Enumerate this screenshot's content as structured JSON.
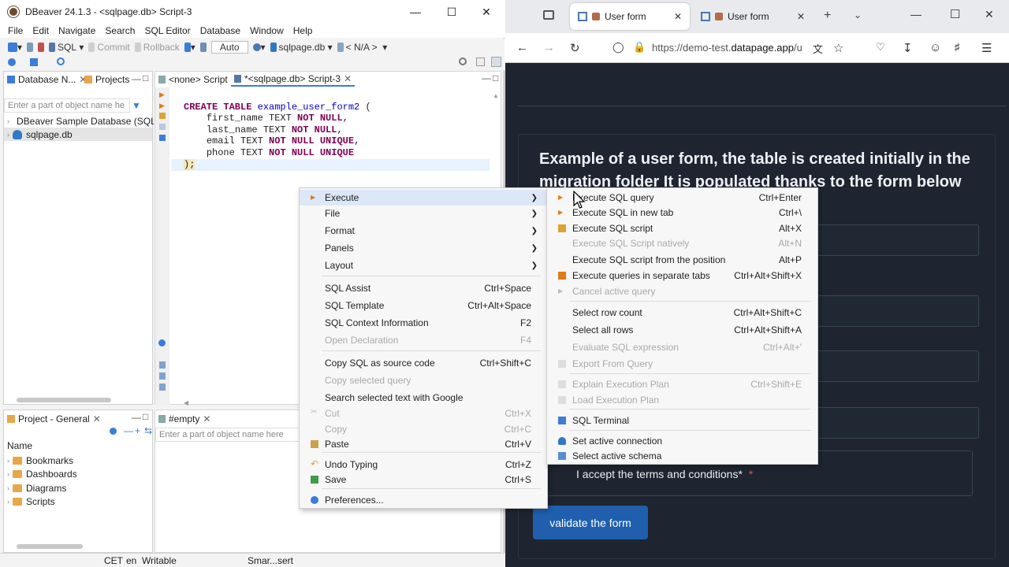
{
  "dbeaver": {
    "window_title": "DBeaver 24.1.3 - <sqlpage.db> Script-3",
    "menu": [
      "File",
      "Edit",
      "Navigate",
      "Search",
      "SQL Editor",
      "Database",
      "Window",
      "Help"
    ],
    "toolbar": {
      "sql_label": "SQL",
      "commit_label": "Commit",
      "rollback_label": "Rollback",
      "auto_label": "Auto",
      "connection_label": "sqlpage.db",
      "schema_label": "< N/A >"
    },
    "db_navigator": {
      "tab_label": "Database N...",
      "projects_tab": "Projects",
      "filter_placeholder": "Enter a part of object name he",
      "items": [
        {
          "label": "DBeaver Sample Database (SQLi"
        },
        {
          "label": "sqlpage.db"
        }
      ]
    },
    "editor": {
      "tabs": [
        {
          "label": "<none> Script"
        },
        {
          "label": "*<sqlpage.db> Script-3"
        }
      ],
      "code_lines": [
        {
          "kw": "CREATE TABLE",
          "name": "example_user_form2",
          "rest": " ("
        },
        {
          "col": "first_name",
          "type": " TEXT ",
          "kw2": "NOT NULL",
          ",": ","
        },
        {
          "col": "last_name",
          "type": " TEXT ",
          "kw2": "NOT NULL",
          ",": ","
        },
        {
          "col": "email",
          "type": " TEXT ",
          "kw2": "NOT NULL UNIQUE",
          ",": ","
        },
        {
          "col": "phone",
          "type": " TEXT ",
          "kw2": "NOT NULL UNIQUE",
          ",": ""
        }
      ],
      "closing": ");"
    },
    "project": {
      "tab_label": "Project - General",
      "header": "Name",
      "items": [
        {
          "label": "Bookmarks"
        },
        {
          "label": "Dashboards"
        },
        {
          "label": "Diagrams"
        },
        {
          "label": "Scripts"
        }
      ]
    },
    "empty_panel": {
      "tab_label": "#empty",
      "filter_placeholder": "Enter a part of object name here"
    },
    "status": {
      "tz": "CET",
      "lang": "en",
      "mode": "Writable",
      "insert": "Smar...sert"
    }
  },
  "context_menu": {
    "items": [
      {
        "label": "Execute",
        "sub": true,
        "hl": true
      },
      {
        "label": "File",
        "sub": true
      },
      {
        "label": "Format",
        "sub": true
      },
      {
        "label": "Panels",
        "sub": true
      },
      {
        "label": "Layout",
        "sub": true
      },
      {
        "label": "SQL Assist",
        "shortcut": "Ctrl+Space"
      },
      {
        "label": "SQL Template",
        "shortcut": "Ctrl+Alt+Space"
      },
      {
        "label": "SQL Context Information",
        "shortcut": "F2"
      },
      {
        "label": "Open Declaration",
        "shortcut": "F4",
        "disabled": true
      },
      {
        "label": "Copy SQL as source code",
        "shortcut": "Ctrl+Shift+C"
      },
      {
        "label": "Copy selected query",
        "disabled": true
      },
      {
        "label": "Search selected text with Google"
      },
      {
        "label": "Cut",
        "shortcut": "Ctrl+X",
        "disabled": true
      },
      {
        "label": "Copy",
        "shortcut": "Ctrl+C",
        "disabled": true
      },
      {
        "label": "Paste",
        "shortcut": "Ctrl+V"
      },
      {
        "label": "Undo Typing",
        "shortcut": "Ctrl+Z"
      },
      {
        "label": "Save",
        "shortcut": "Ctrl+S"
      },
      {
        "label": "Preferences..."
      }
    ]
  },
  "execute_submenu": {
    "items": [
      {
        "label": "Execute SQL query",
        "shortcut": "Ctrl+Enter"
      },
      {
        "label": "Execute SQL in new tab",
        "shortcut": "Ctrl+\\"
      },
      {
        "label": "Execute SQL script",
        "shortcut": "Alt+X"
      },
      {
        "label": "Execute SQL Script natively",
        "shortcut": "Alt+N",
        "disabled": true
      },
      {
        "label": "Execute SQL script from the position",
        "shortcut": "Alt+P"
      },
      {
        "label": "Execute queries in separate tabs",
        "shortcut": "Ctrl+Alt+Shift+X"
      },
      {
        "label": "Cancel active query",
        "disabled": true
      },
      {
        "label": "Select row count",
        "shortcut": "Ctrl+Alt+Shift+C"
      },
      {
        "label": "Select all rows",
        "shortcut": "Ctrl+Alt+Shift+A"
      },
      {
        "label": "Evaluate SQL expression",
        "shortcut": "Ctrl+Alt+'",
        "disabled": true
      },
      {
        "label": "Export From Query",
        "disabled": true
      },
      {
        "label": "Explain Execution Plan",
        "shortcut": "Ctrl+Shift+E",
        "disabled": true
      },
      {
        "label": "Load Execution Plan",
        "disabled": true
      },
      {
        "label": "SQL Terminal"
      },
      {
        "label": "Set active connection"
      },
      {
        "label": "Select active schema"
      }
    ]
  },
  "browser": {
    "tabs": [
      {
        "label": "User form"
      },
      {
        "label": "User form"
      }
    ],
    "url_prefix": "https://demo-test.",
    "url_domain": "datapage.app",
    "url_suffix": "/u",
    "page": {
      "heading": "Example of a user form, the table is created initially in the migration folder It is populated thanks to the form below",
      "checkbox_label": "I accept the terms and conditions*",
      "required_mark": "*",
      "submit_label": "validate the form"
    }
  }
}
